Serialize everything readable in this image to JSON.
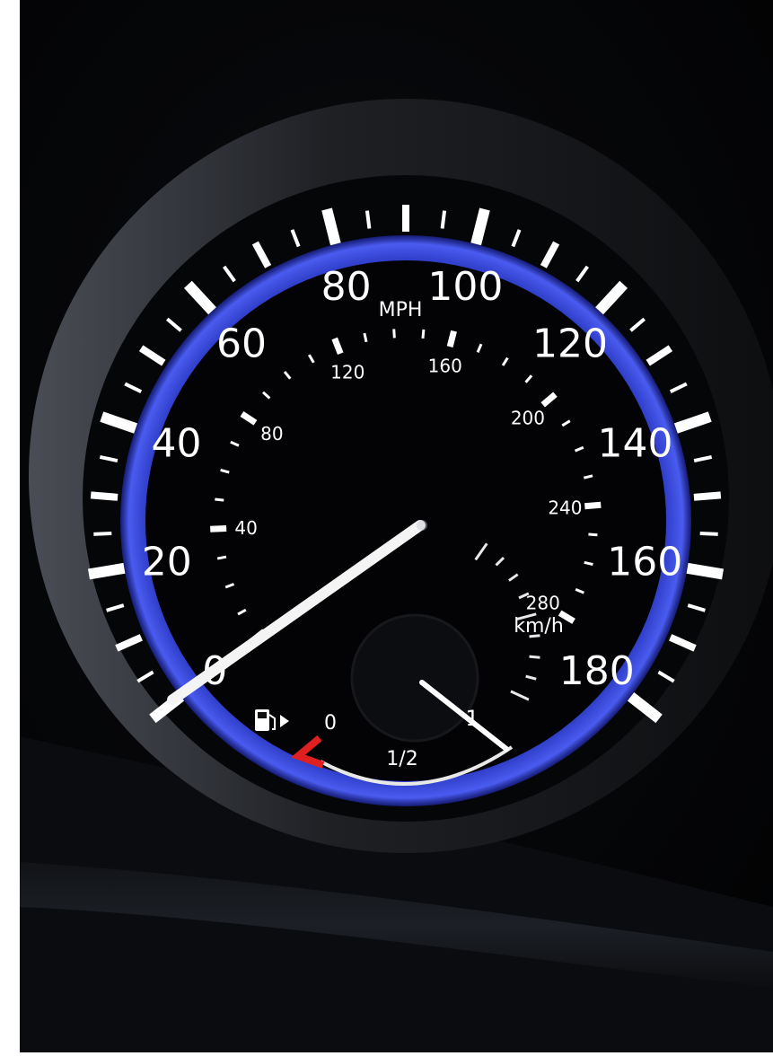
{
  "speedometer": {
    "unit_mph": "MPH",
    "unit_kmh": "km/h",
    "mph_labels": [
      "0",
      "20",
      "40",
      "60",
      "80",
      "100",
      "120",
      "140",
      "160",
      "180"
    ],
    "kmh_labels": [
      "40",
      "80",
      "120",
      "160",
      "200",
      "240",
      "280"
    ],
    "current_speed_mph": 0
  },
  "fuel_gauge": {
    "label_empty": "0",
    "label_half": "1/2",
    "label_full": "1",
    "level_fraction": 1.0,
    "icon": "fuel-pump-icon"
  },
  "colors": {
    "backlight_blue": "#2f3fd6",
    "needle": "#f4f4f4",
    "warning_red": "#e02020",
    "markings": "#ffffff"
  }
}
